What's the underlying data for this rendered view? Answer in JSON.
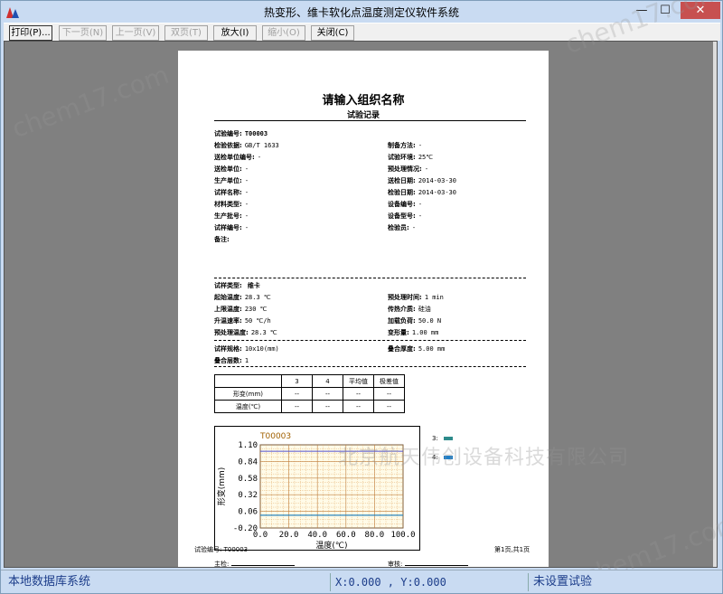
{
  "window": {
    "title": "热变形、维卡软化点温度测定仪软件系统",
    "minimize_glyph": "—",
    "maximize_glyph": "☐",
    "close_glyph": "✕"
  },
  "toolbar": {
    "buttons": [
      {
        "label": "打印(P)...",
        "enabled": true
      },
      {
        "label": "下一页(N)",
        "enabled": false
      },
      {
        "label": "上一页(V)",
        "enabled": false
      },
      {
        "label": "双页(T)",
        "enabled": false
      },
      {
        "label": "放大(I)",
        "enabled": true
      },
      {
        "label": "缩小(O)",
        "enabled": false
      },
      {
        "label": "关闭(C)",
        "enabled": true
      }
    ]
  },
  "report": {
    "org_name": "请输入组织名称",
    "record_title": "试验记录",
    "fields_left": [
      {
        "key": "试验编号:",
        "value": "T00003",
        "bold_value": true
      },
      {
        "key": "检验依据:",
        "value": "GB/T 1633"
      },
      {
        "key": "送检单位编号:",
        "value": "-"
      },
      {
        "key": "送检单位:",
        "value": "-"
      },
      {
        "key": "生产单位:",
        "value": "-"
      },
      {
        "key": "试样名称:",
        "value": "-"
      },
      {
        "key": "材料类型:",
        "value": "-"
      },
      {
        "key": "生产批号:",
        "value": "-"
      },
      {
        "key": "试样编号:",
        "value": "-"
      },
      {
        "key": "备注:",
        "value": ""
      }
    ],
    "fields_right": [
      {
        "key": "制备方法:",
        "value": "-"
      },
      {
        "key": "试验环境:",
        "value": "25℃"
      },
      {
        "key": "预处理情况:",
        "value": "-"
      },
      {
        "key": "送检日期:",
        "value": "2014-03-30"
      },
      {
        "key": "检验日期:",
        "value": "2014-03-30"
      },
      {
        "key": "设备编号:",
        "value": "-"
      },
      {
        "key": "设备型号:",
        "value": "-"
      },
      {
        "key": "检验员:",
        "value": "-"
      }
    ],
    "sample_type_key": "试样类型:",
    "sample_type_value": "维卡",
    "params_left": [
      {
        "key": "起始温度:",
        "value": "28.3 ℃"
      },
      {
        "key": "上限温度:",
        "value": "230 ℃"
      },
      {
        "key": "升温速率:",
        "value": "50 ℃/h"
      },
      {
        "key": "预处理温度:",
        "value": "28.3 ℃"
      }
    ],
    "params_right": [
      {
        "key": "预处理时间:",
        "value": "1 min"
      },
      {
        "key": "传热介质:",
        "value": "硅油"
      },
      {
        "key": "加载负荷:",
        "value": "50.0 N"
      },
      {
        "key": "变形量:",
        "value": "1.00 mm"
      }
    ],
    "spec_left": [
      {
        "key": "试样规格:",
        "value": "10x10(mm)"
      },
      {
        "key": "叠合层数:",
        "value": "1"
      }
    ],
    "spec_right": [
      {
        "key": "叠合厚度:",
        "value": "5.00 mm"
      }
    ],
    "table": {
      "headers": [
        "",
        "3",
        "4",
        "平均值",
        "极差值"
      ],
      "rows": [
        [
          "形变(mm)",
          "--",
          "--",
          "--",
          "--"
        ],
        [
          "温度(℃)",
          "--",
          "--",
          "--",
          "--"
        ]
      ]
    },
    "legend": [
      {
        "label": "3:",
        "color": "#2e8b8b"
      },
      {
        "label": "4:",
        "color": "#1f7fc8"
      }
    ],
    "footer": {
      "left_sign": "主检:",
      "right_sign": "审核:",
      "test_id_label": "试验编号: T00003",
      "page_label": "第1页,共1页"
    }
  },
  "chart_data": {
    "type": "line",
    "title": "T00003",
    "xlabel": "温度(℃)",
    "ylabel": "形变(mm)",
    "xlim": [
      0,
      100
    ],
    "ylim": [
      -0.2,
      1.1
    ],
    "xticks": [
      "0.0",
      "20.0",
      "40.0",
      "60.0",
      "80.0",
      "100.0"
    ],
    "yticks": [
      "1.10",
      "0.84",
      "0.58",
      "0.32",
      "0.06",
      "-0.20"
    ],
    "grid": true,
    "series": [
      {
        "name": "3",
        "color": "#2e8b8b",
        "values": [
          {
            "x": 0,
            "y": 0.0
          },
          {
            "x": 100,
            "y": 0.0
          }
        ]
      },
      {
        "name": "4",
        "color": "#1f7fc8",
        "values": [
          {
            "x": 0,
            "y": 0.0
          },
          {
            "x": 100,
            "y": 0.0
          }
        ]
      }
    ],
    "hline": {
      "y": 1.0,
      "color": "#5050d0"
    }
  },
  "watermarks": {
    "repeat": "chem17.com",
    "company": "北京航天伟创设备科技有限公司"
  },
  "status": {
    "system": "本地数据库系统",
    "coords": "X:0.000 , Y:0.000",
    "test_state": "未设置试验"
  }
}
